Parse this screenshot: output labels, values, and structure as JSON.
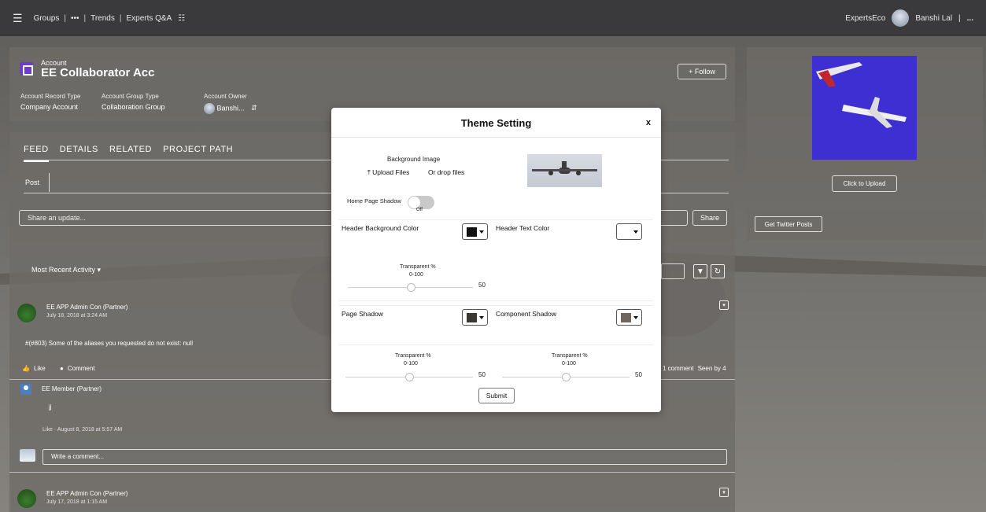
{
  "topbar": {
    "groups": "Groups",
    "dots": "•••",
    "trends": "Trends",
    "experts": "Experts Q&A",
    "right_label": "ExpertsEco",
    "user": "Banshi Lal",
    "right_dots": "..."
  },
  "account": {
    "small_label": "Account",
    "name": "EE Collaborator Acc",
    "record_type_label": "Account Record Type",
    "record_type_value": "Company Account",
    "group_type_label": "Account Group Type",
    "group_type_value": "Collaboration Group",
    "owner_label": "Account Owner",
    "owner_value": "Banshi...",
    "follow_label": "+ Follow"
  },
  "tabs": [
    "FEED",
    "DETAILS",
    "RELATED",
    "PROJECT PATH"
  ],
  "feed": {
    "post_tab": "Post",
    "share_placeholder": "Share an update...",
    "share_button": "Share",
    "sort_label": "Most Recent Activity",
    "posts": [
      {
        "author": "EE APP Admin Con (Partner)",
        "date": "July 18, 2018 at 3:24 AM",
        "body": "#(#803) Some of the aliases you requested do not exist: null",
        "like": "Like",
        "comment": "Comment",
        "comments_count": "1 comment",
        "seen": "Seen by 4"
      },
      {
        "author": "EE APP Admin Con (Partner)",
        "date": "July 17, 2018 at 1:15 AM"
      }
    ],
    "reply": {
      "author": "EE Member (Partner)",
      "body": "jj",
      "like": "Like",
      "date": "August 8, 2018 at 5:57 AM"
    },
    "write_placeholder": "Write a comment..."
  },
  "sidebar": {
    "upload_button": "Click to Upload",
    "twitter_button": "Get Twitter Posts"
  },
  "modal": {
    "title": "Theme Setting",
    "close": "x",
    "bg_image_label": "Background Image",
    "upload_files": "Upload Files",
    "drop_files": "Or drop files",
    "home_shadow_label": "Home Page Shadow",
    "toggle_state": "Off",
    "header_bg_label": "Header Background Color",
    "header_text_label": "Header Text Color",
    "transparent_label": "Transparent %",
    "range_label": "0-100",
    "transparent_value_1": "50",
    "page_shadow_label": "Page Shadow",
    "component_shadow_label": "Component Shadow",
    "transparent_value_2": "50",
    "transparent_value_3": "50",
    "submit": "Submit",
    "colors": {
      "header_bg": "#111111",
      "header_text": "#ffffff",
      "page_shadow": "#3b3733",
      "component_shadow": "#6f6660"
    }
  }
}
